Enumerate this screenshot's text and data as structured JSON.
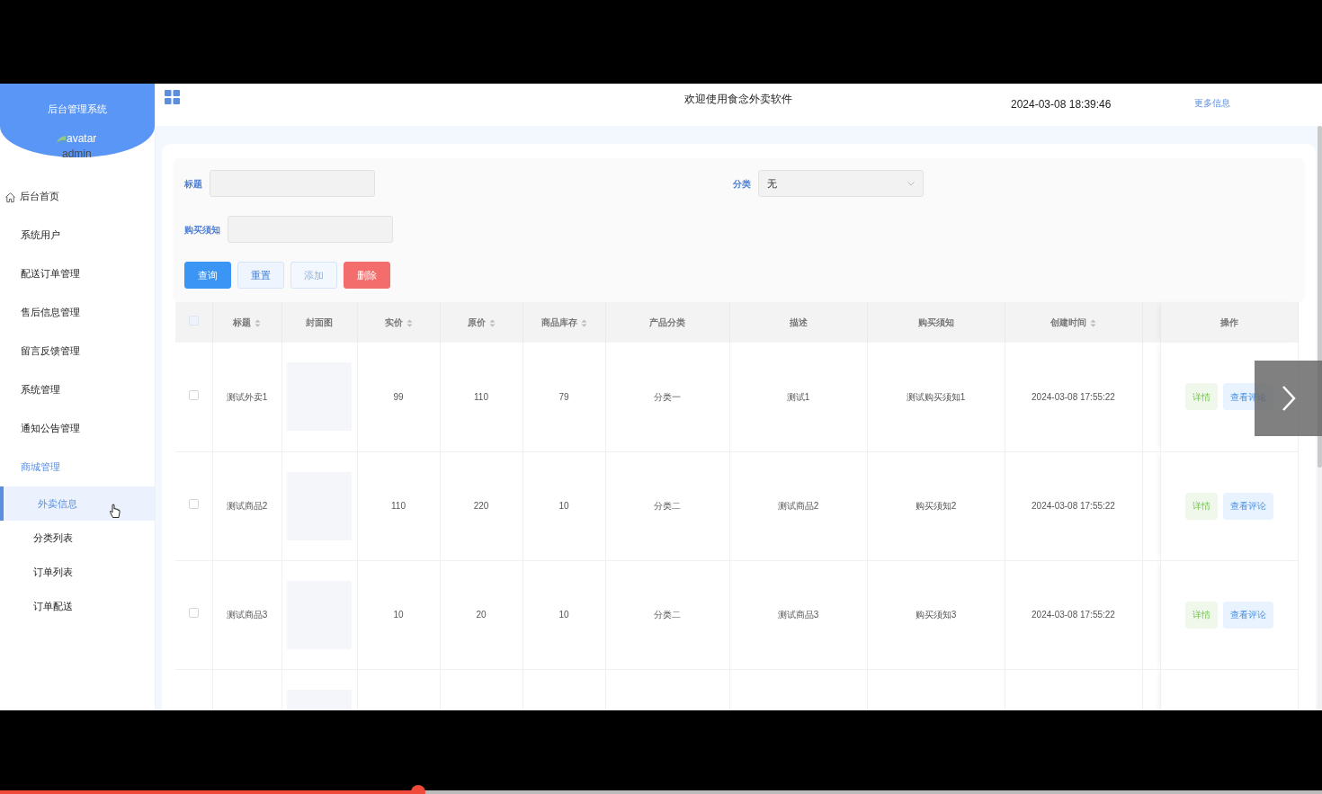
{
  "sidebar": {
    "title": "后台管理系统",
    "avatar_alt": "avatar",
    "username": "admin",
    "items": [
      {
        "label": "后台首页",
        "kind": "home",
        "expanded": false
      },
      {
        "label": "系统用户",
        "kind": "plain",
        "expanded": false
      },
      {
        "label": "配送订单管理",
        "kind": "plain",
        "expanded": false
      },
      {
        "label": "售后信息管理",
        "kind": "plain",
        "expanded": false
      },
      {
        "label": "留言反馈管理",
        "kind": "plain",
        "expanded": false
      },
      {
        "label": "系统管理",
        "kind": "plain",
        "expanded": false
      },
      {
        "label": "通知公告管理",
        "kind": "plain",
        "expanded": false
      },
      {
        "label": "商城管理",
        "kind": "plain",
        "expanded": true,
        "children": [
          {
            "label": "外卖信息",
            "selected": true
          },
          {
            "label": "分类列表",
            "selected": false
          },
          {
            "label": "订单列表",
            "selected": false
          },
          {
            "label": "订单配送",
            "selected": false
          }
        ]
      }
    ]
  },
  "header": {
    "title": "欢迎使用食念外卖软件",
    "datetime": "2024-03-08 18:39:46",
    "link": "更多信息"
  },
  "search": {
    "rows": [
      [
        {
          "label": "标题",
          "kind": "text"
        },
        {
          "label": "分类",
          "kind": "select",
          "value": "无"
        }
      ],
      [
        {
          "label": "购买须知",
          "kind": "text"
        }
      ]
    ],
    "buttons": [
      {
        "label": "查询",
        "kind": "primary",
        "disabled": false
      },
      {
        "label": "重置",
        "kind": "plain",
        "disabled": false
      },
      {
        "label": "添加",
        "kind": "plain",
        "disabled": true
      },
      {
        "label": "删除",
        "kind": "danger",
        "disabled": false
      }
    ]
  },
  "table": {
    "columns": [
      {
        "kind": "checkbox",
        "checked": false
      },
      {
        "kind": "text",
        "label": "标题",
        "sortable": true
      },
      {
        "kind": "image",
        "label": "封面图",
        "sortable": false
      },
      {
        "kind": "text",
        "label": "实价",
        "sortable": true
      },
      {
        "kind": "text",
        "label": "原价",
        "sortable": true
      },
      {
        "kind": "text",
        "label": "商品库存",
        "sortable": true
      },
      {
        "kind": "text",
        "label": "产品分类",
        "sortable": false
      },
      {
        "kind": "text",
        "label": "描述",
        "sortable": false
      },
      {
        "kind": "text",
        "label": "购买须知",
        "sortable": false
      },
      {
        "kind": "text",
        "label": "创建时间",
        "sortable": true
      },
      {
        "kind": "blank"
      },
      {
        "kind": "actions",
        "label": "操作",
        "sortable": false
      }
    ],
    "rows": [
      {
        "checked": false,
        "cells": [
          "",
          "测试外卖1",
          "",
          "99",
          "110",
          "79",
          "分类一",
          "测试1",
          "测试购买须知1",
          "2024-03-08 17:55:22"
        ],
        "actions": [
          {
            "label": "详情",
            "kind": "success"
          },
          {
            "label": "查看评论",
            "kind": "primary"
          }
        ]
      },
      {
        "checked": false,
        "cells": [
          "",
          "测试商品2",
          "",
          "110",
          "220",
          "10",
          "分类二",
          "测试商品2",
          "购买须知2",
          "2024-03-08 17:55:22"
        ],
        "actions": [
          {
            "label": "详情",
            "kind": "success"
          },
          {
            "label": "查看评论",
            "kind": "primary"
          }
        ]
      },
      {
        "checked": false,
        "cells": [
          "",
          "测试商品3",
          "",
          "10",
          "20",
          "10",
          "分类二",
          "测试商品3",
          "购买须知3",
          "2024-03-08 17:55:22"
        ],
        "actions": [
          {
            "label": "详情",
            "kind": "success"
          },
          {
            "label": "查看评论",
            "kind": "primary"
          }
        ]
      }
    ],
    "more_rows_below": true
  },
  "video_player": {
    "progress": {
      "level": 0.316
    },
    "next_button": true
  }
}
